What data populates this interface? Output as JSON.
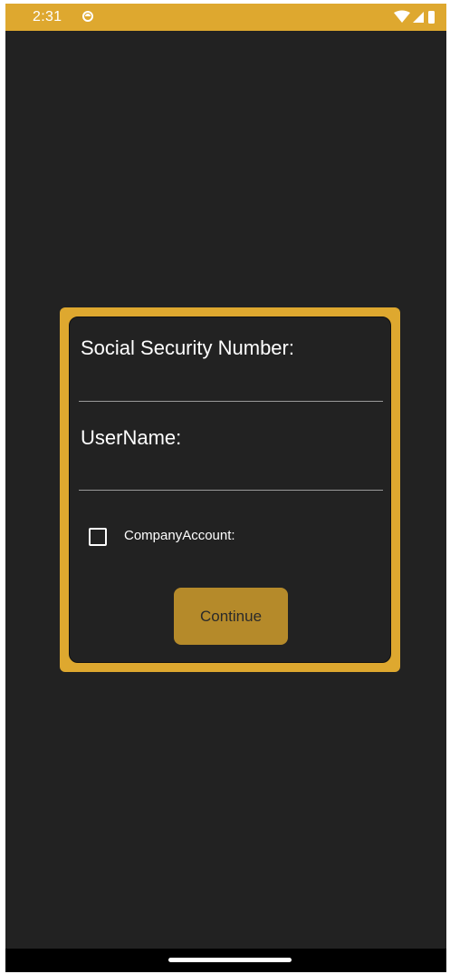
{
  "status_bar": {
    "time": "2:31",
    "notification_icon": "app-notification-icon",
    "icons": [
      "wifi-icon",
      "cell-signal-icon",
      "battery-icon"
    ]
  },
  "form": {
    "ssn_label": "Social Security Number:",
    "ssn_value": "",
    "username_label": "UserName:",
    "username_value": "",
    "company_account_label": "CompanyAccount:",
    "company_account_checked": false,
    "continue_label": "Continue"
  },
  "colors": {
    "accent": "#dea82f",
    "button": "#b58a2a",
    "background": "#222222"
  }
}
